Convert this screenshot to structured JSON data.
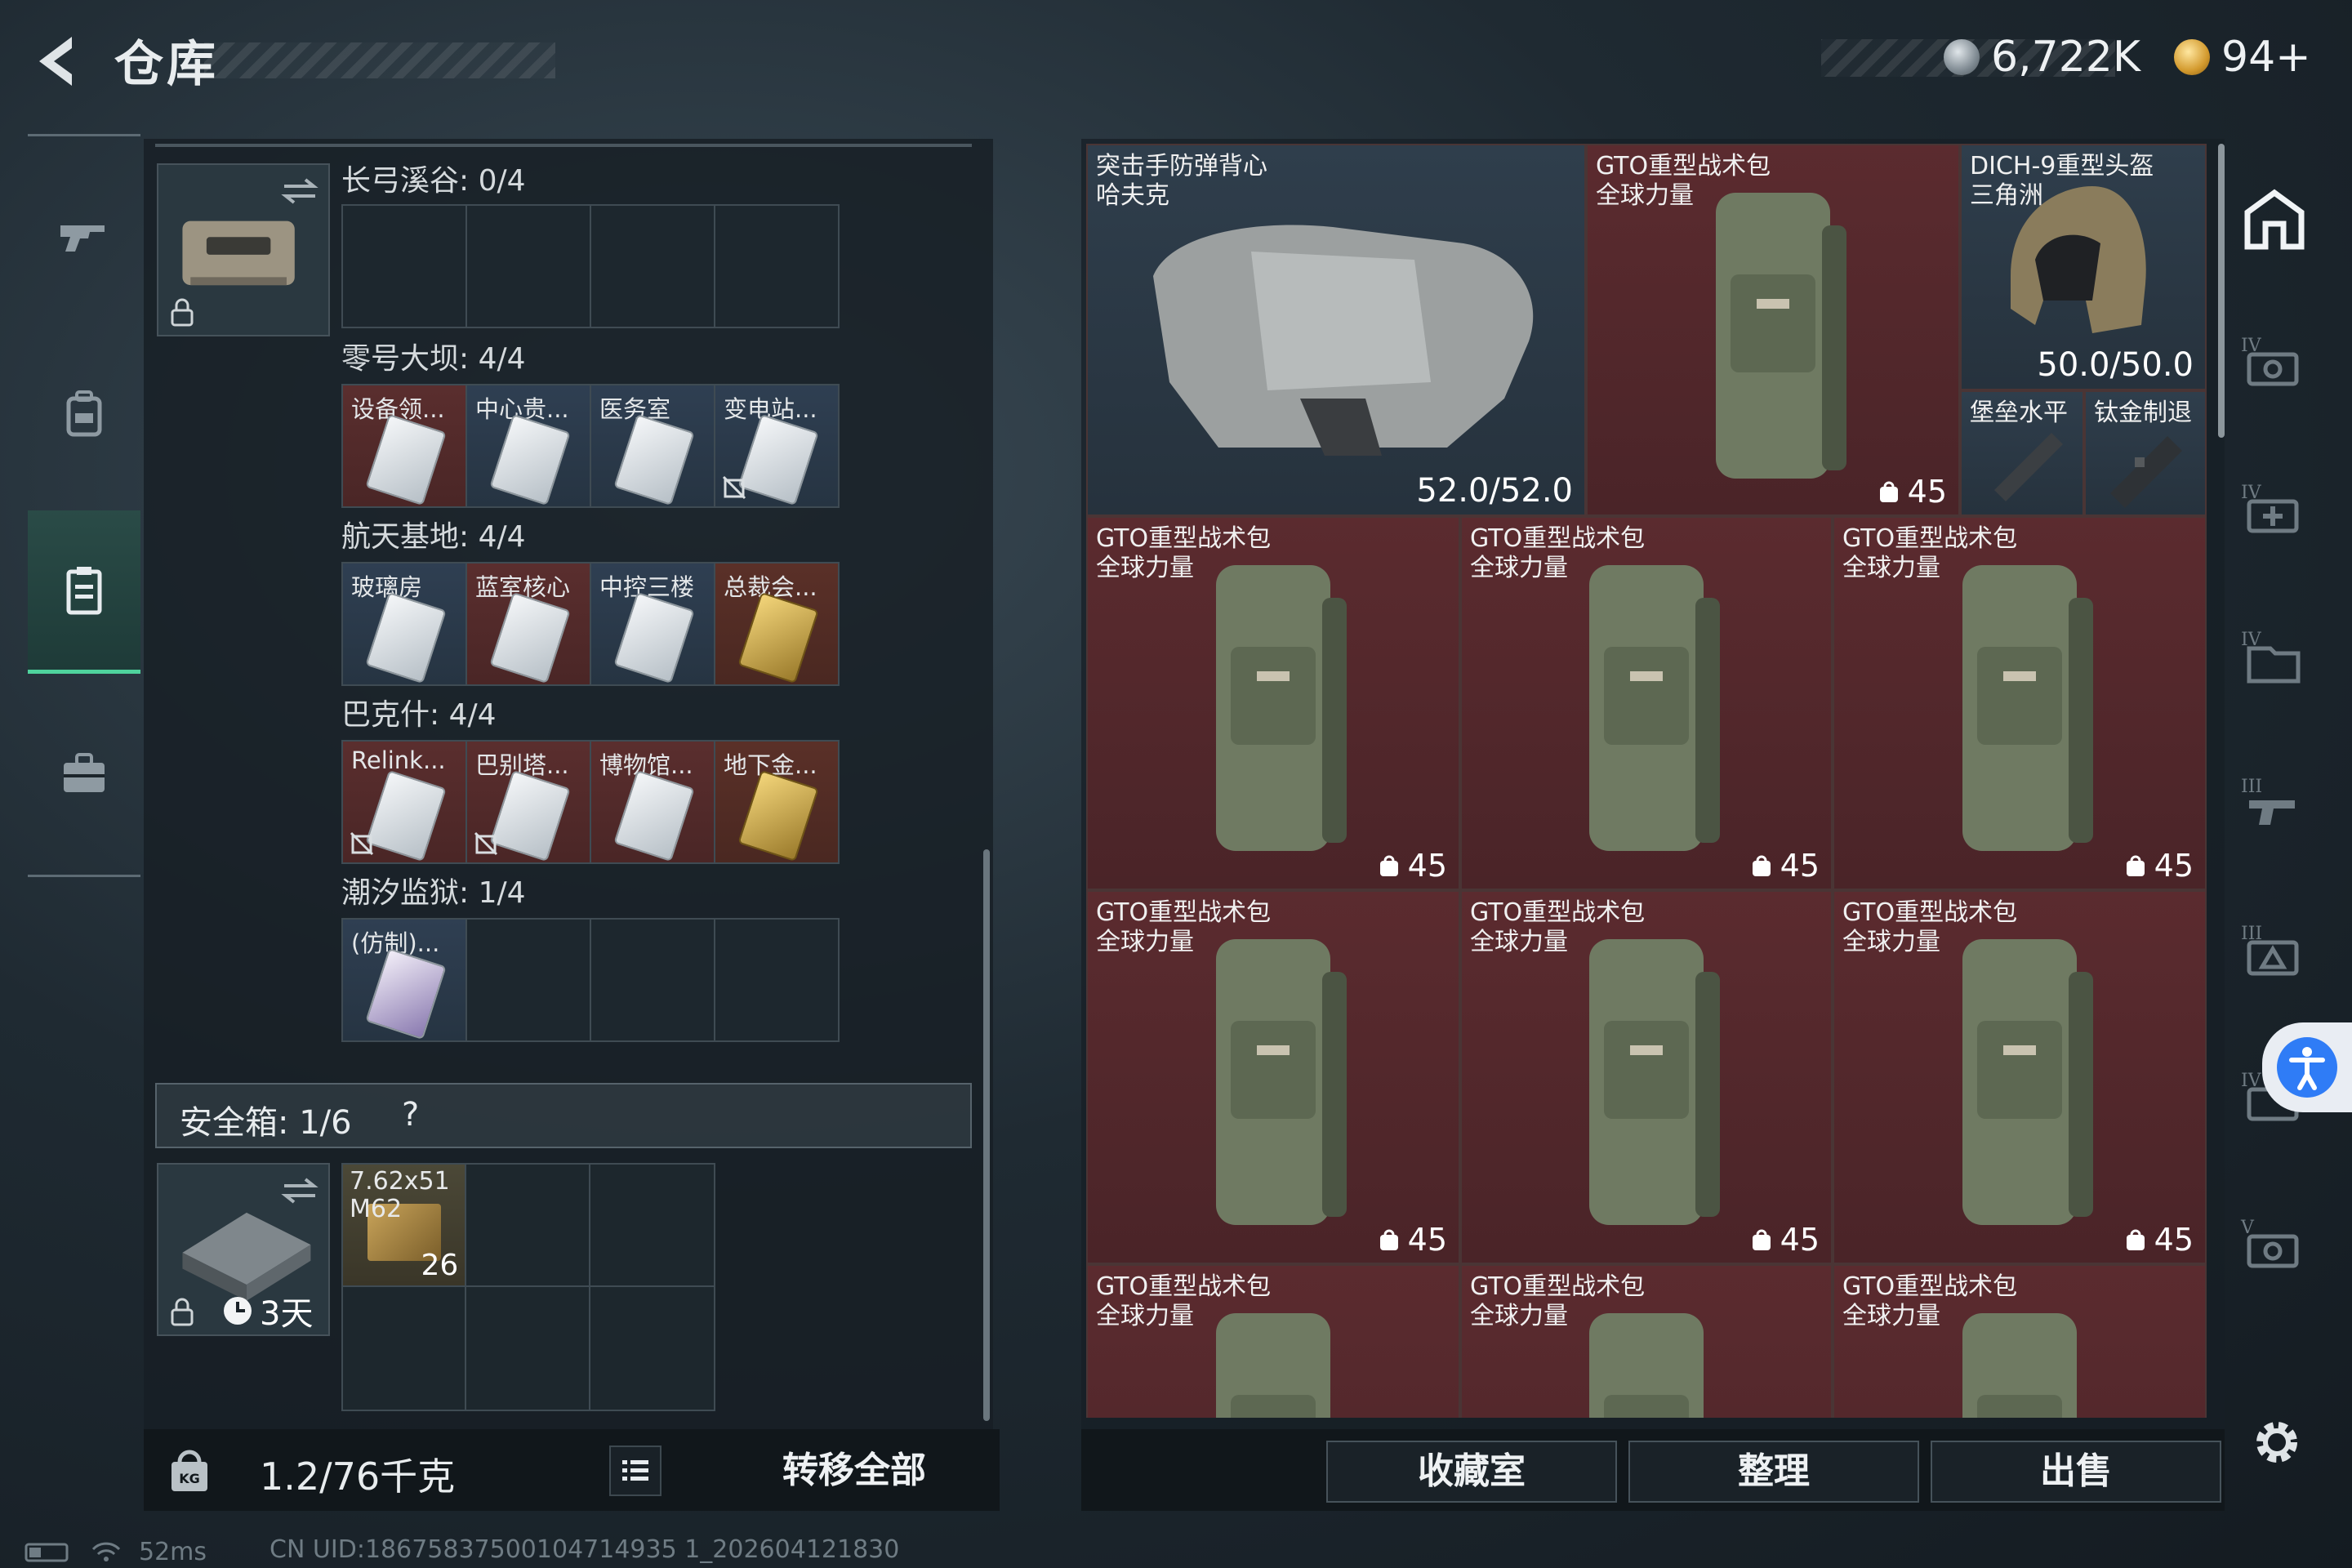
{
  "header": {
    "title": "仓库",
    "currency": [
      {
        "icon": "silver-coin-icon",
        "value": "6,722K"
      },
      {
        "icon": "gold-triangle-coin-icon",
        "value": "94+"
      }
    ]
  },
  "left_nav": [
    {
      "icon": "gun-icon",
      "active": false
    },
    {
      "icon": "backpack-icon",
      "active": false
    },
    {
      "icon": "keycard-case-icon",
      "active": true
    },
    {
      "icon": "briefcase-icon",
      "active": false
    }
  ],
  "keycard_sections": [
    {
      "title": "长弓溪谷: 0/4",
      "slots": []
    },
    {
      "title": "零号大坝: 4/4",
      "slots": [
        "设备领...",
        "中心贵...",
        "医务室",
        "变电站..."
      ]
    },
    {
      "title": "航天基地: 4/4",
      "slots": [
        "玻璃房",
        "蓝室核心",
        "中控三楼",
        "总裁会..."
      ]
    },
    {
      "title": "巴克什: 4/4",
      "slots": [
        "Relink...",
        "巴别塔...",
        "博物馆...",
        "地下金..."
      ]
    },
    {
      "title": "潮汐监狱: 1/4",
      "slots": [
        "(仿制)..."
      ]
    }
  ],
  "safe_box": {
    "header": "安全箱: 1/6",
    "help": "?",
    "timer": "3天",
    "ammo": {
      "label": "7.62x51\nM62",
      "count": "26"
    }
  },
  "left_footer": {
    "weight": "1.2/76千克",
    "transfer_all": "转移全部"
  },
  "stash_items": [
    {
      "name": "突击手防弹背心\n哈夫克",
      "durability": "52.0/52.0"
    },
    {
      "name": "GTO重型战术包\n全球力量",
      "capacity": "45"
    },
    {
      "name": "DICH-9重型头盔\n三角洲",
      "durability": "50.0/50.0"
    },
    {
      "name": "堡垒水平"
    },
    {
      "name": "钛金制退"
    },
    {
      "name": "GTO重型战术包\n全球力量",
      "capacity": "45"
    },
    {
      "name": "GTO重型战术包\n全球力量",
      "capacity": "45"
    },
    {
      "name": "GTO重型战术包\n全球力量",
      "capacity": "45"
    },
    {
      "name": "GTO重型战术包\n全球力量",
      "capacity": "45"
    },
    {
      "name": "GTO重型战术包\n全球力量",
      "capacity": "45"
    },
    {
      "name": "GTO重型战术包\n全球力量",
      "capacity": "45"
    },
    {
      "name": "GTO重型战术包\n全球力量"
    },
    {
      "name": "GTO重型战术包\n全球力量"
    },
    {
      "name": "GTO重型战术包\n全球力量"
    }
  ],
  "right_footer": {
    "collection": "收藏室",
    "organize": "整理",
    "sell": "出售"
  },
  "filter_icons": [
    "home-stash-icon",
    "tier4-ammo-filter-icon",
    "tier4-medical-filter-icon",
    "tier4-docs-filter-icon",
    "tier3-weapon-filter-icon",
    "tier3-armor-filter-icon",
    "tier4-misc-filter-icon",
    "tier5-ammo-filter-icon"
  ],
  "status_bar": {
    "ping": "52ms",
    "uid": "CN UID:18675837500104714935 1_202604121830"
  }
}
